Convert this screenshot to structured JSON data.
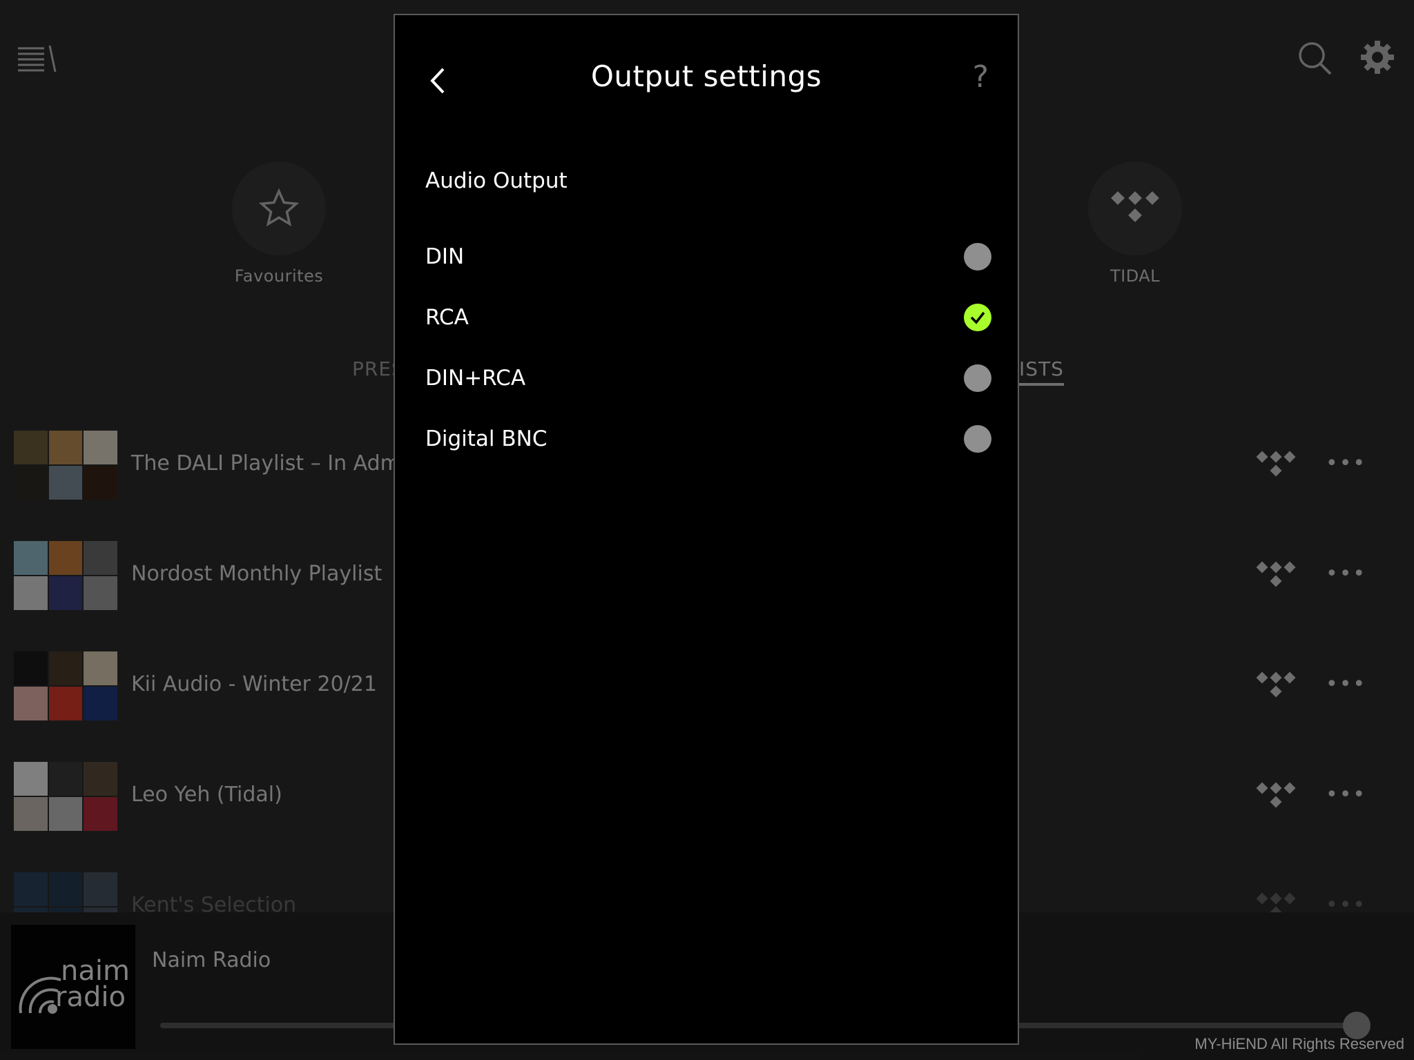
{
  "background": {
    "sources": [
      {
        "label": "Favourites",
        "icon": "star-icon"
      },
      {
        "label": "TIDAL",
        "icon": "tidal-icon"
      }
    ],
    "tabs": [
      {
        "label": "PRES",
        "active": false
      },
      {
        "label": "ISTS",
        "active": true
      }
    ],
    "playlists": [
      {
        "title": "The DALI Playlist – In Admira",
        "art": [
          "#6b5a3a",
          "#b88a52",
          "#d9d0c2",
          "#2f2a26",
          "#7a8a96",
          "#3a2418"
        ]
      },
      {
        "title": "Nordost Monthly Playlist",
        "art": [
          "#8fb8c9",
          "#c2793a",
          "#6a6a6a",
          "#d5d5d5",
          "#3a3f7a",
          "#9a9a9a"
        ]
      },
      {
        "title": "Kii Audio - Winter 20/21",
        "art": [
          "#1a1a1a",
          "#4a3a2a",
          "#d8c9b0",
          "#e2b1a8",
          "#d63a2a",
          "#1e3a7a"
        ]
      },
      {
        "title": "Leo Yeh (Tidal)",
        "art": [
          "#e8e8e8",
          "#3a3a3a",
          "#5a4a3a",
          "#c2b8b0",
          "#bcbcbc",
          "#b02a3a"
        ]
      },
      {
        "title": "Kent's Selection",
        "art": [
          "#2a6ab0",
          "#1e5a9a",
          "#7a9ac0",
          "#2a6ab0",
          "#1e5a9a",
          "#7a9ac0"
        ]
      }
    ],
    "more_label": "•••",
    "player": {
      "station": "Naim Radio",
      "logo_text_1": "naim",
      "logo_text_2": "radio",
      "progress": 0.99
    },
    "watermark": "MY-HiEND All Rights Reserved"
  },
  "modal": {
    "title": "Output settings",
    "help_label": "?",
    "section_label": "Audio Output",
    "options": [
      {
        "label": "DIN",
        "selected": false
      },
      {
        "label": "RCA",
        "selected": true
      },
      {
        "label": "DIN+RCA",
        "selected": false
      },
      {
        "label": "Digital BNC",
        "selected": false
      }
    ],
    "accent_color": "#a8ff2b"
  }
}
